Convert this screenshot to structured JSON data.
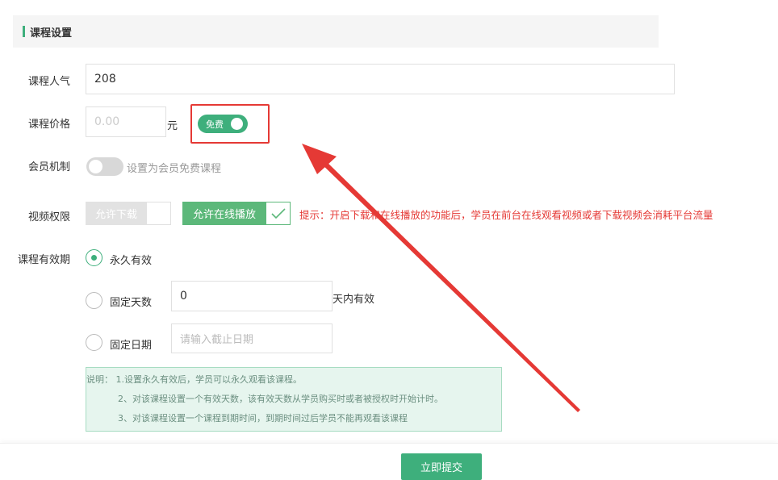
{
  "section": {
    "title": "课程设置"
  },
  "popularity": {
    "label": "课程人气",
    "value": "208"
  },
  "price": {
    "label": "课程价格",
    "placeholder": "0.00",
    "unit": "元",
    "toggle_label": "免费",
    "toggle_on": true
  },
  "membership": {
    "label": "会员机制",
    "toggle_on": false,
    "hint": "设置为会员免费课程"
  },
  "video": {
    "label": "视频权限",
    "download_label": "允许下载",
    "online_label": "允许在线播放",
    "tip": "提示：开启下载和在线播放的功能后，学员在前台在线观看视频或者下载视频会消耗平台流量"
  },
  "validity": {
    "label": "课程有效期",
    "options": [
      {
        "label": "永久有效",
        "checked": true
      },
      {
        "label": "固定天数",
        "checked": false,
        "value": "0",
        "suffix": "天内有效"
      },
      {
        "label": "固定日期",
        "checked": false,
        "placeholder": "请输入截止日期"
      }
    ]
  },
  "note": {
    "lines": [
      "说明： 1.设置永久有效后，学员可以永久观看该课程。",
      "2、对该课程设置一个有效天数，该有效天数从学员购买时或者被授权时开始计时。",
      "3、对该课程设置一个课程到期时间，到期时间过后学员不能再观看该课程"
    ]
  },
  "submit_label": "立即提交",
  "colors": {
    "accent": "#3eaf7c",
    "alert": "#e53935",
    "highlight": "#e53935"
  }
}
